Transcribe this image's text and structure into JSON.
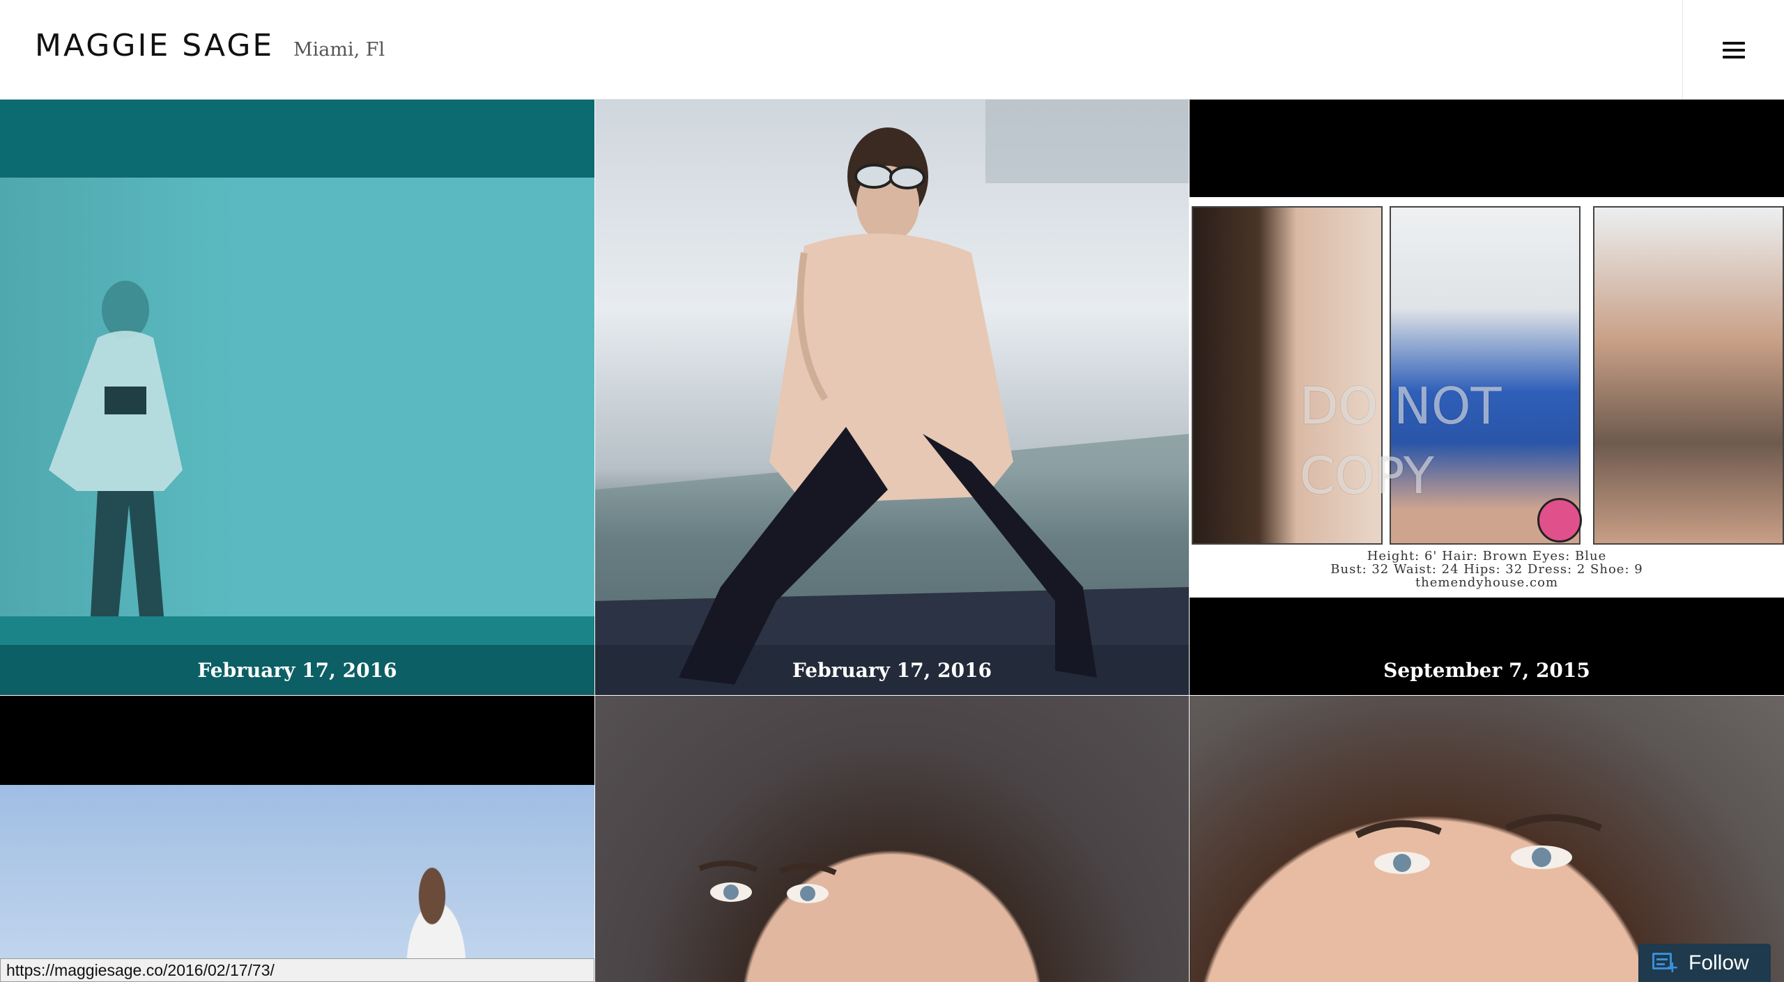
{
  "header": {
    "site_title": "MAGGIE SAGE",
    "tagline": "Miami, Fl",
    "menu_icon": "hamburger-menu-icon"
  },
  "grid": {
    "tiles": [
      {
        "date": "February 17, 2016",
        "image": "teal-tinted-model-photo"
      },
      {
        "date": "February 17, 2016",
        "image": "model-fur-coat-sunglasses-photo"
      },
      {
        "date": "September 7, 2015",
        "image": "comp-card-photo",
        "watermark": "DO NOT COPY",
        "stats_line1": "Height: 6'  Hair: Brown  Eyes: Blue",
        "stats_line2": "Bust: 32  Waist: 24  Hips: 32  Dress: 2  Shoe: 9",
        "stats_line3": "themendyhouse.com"
      },
      {
        "image": "model-sky-photo"
      },
      {
        "image": "headshot-photo"
      },
      {
        "image": "headshot-closeup-photo"
      }
    ]
  },
  "status_bar": {
    "url": "https://maggiesage.co/2016/02/17/73/"
  },
  "follow": {
    "label": "Follow",
    "icon": "reader-follow-icon"
  },
  "colors": {
    "teal_dark": "#0b6b70",
    "teal_light": "#5bbac1",
    "follow_bg": "#1e3a4c",
    "follow_accent": "#3a8fd8"
  }
}
